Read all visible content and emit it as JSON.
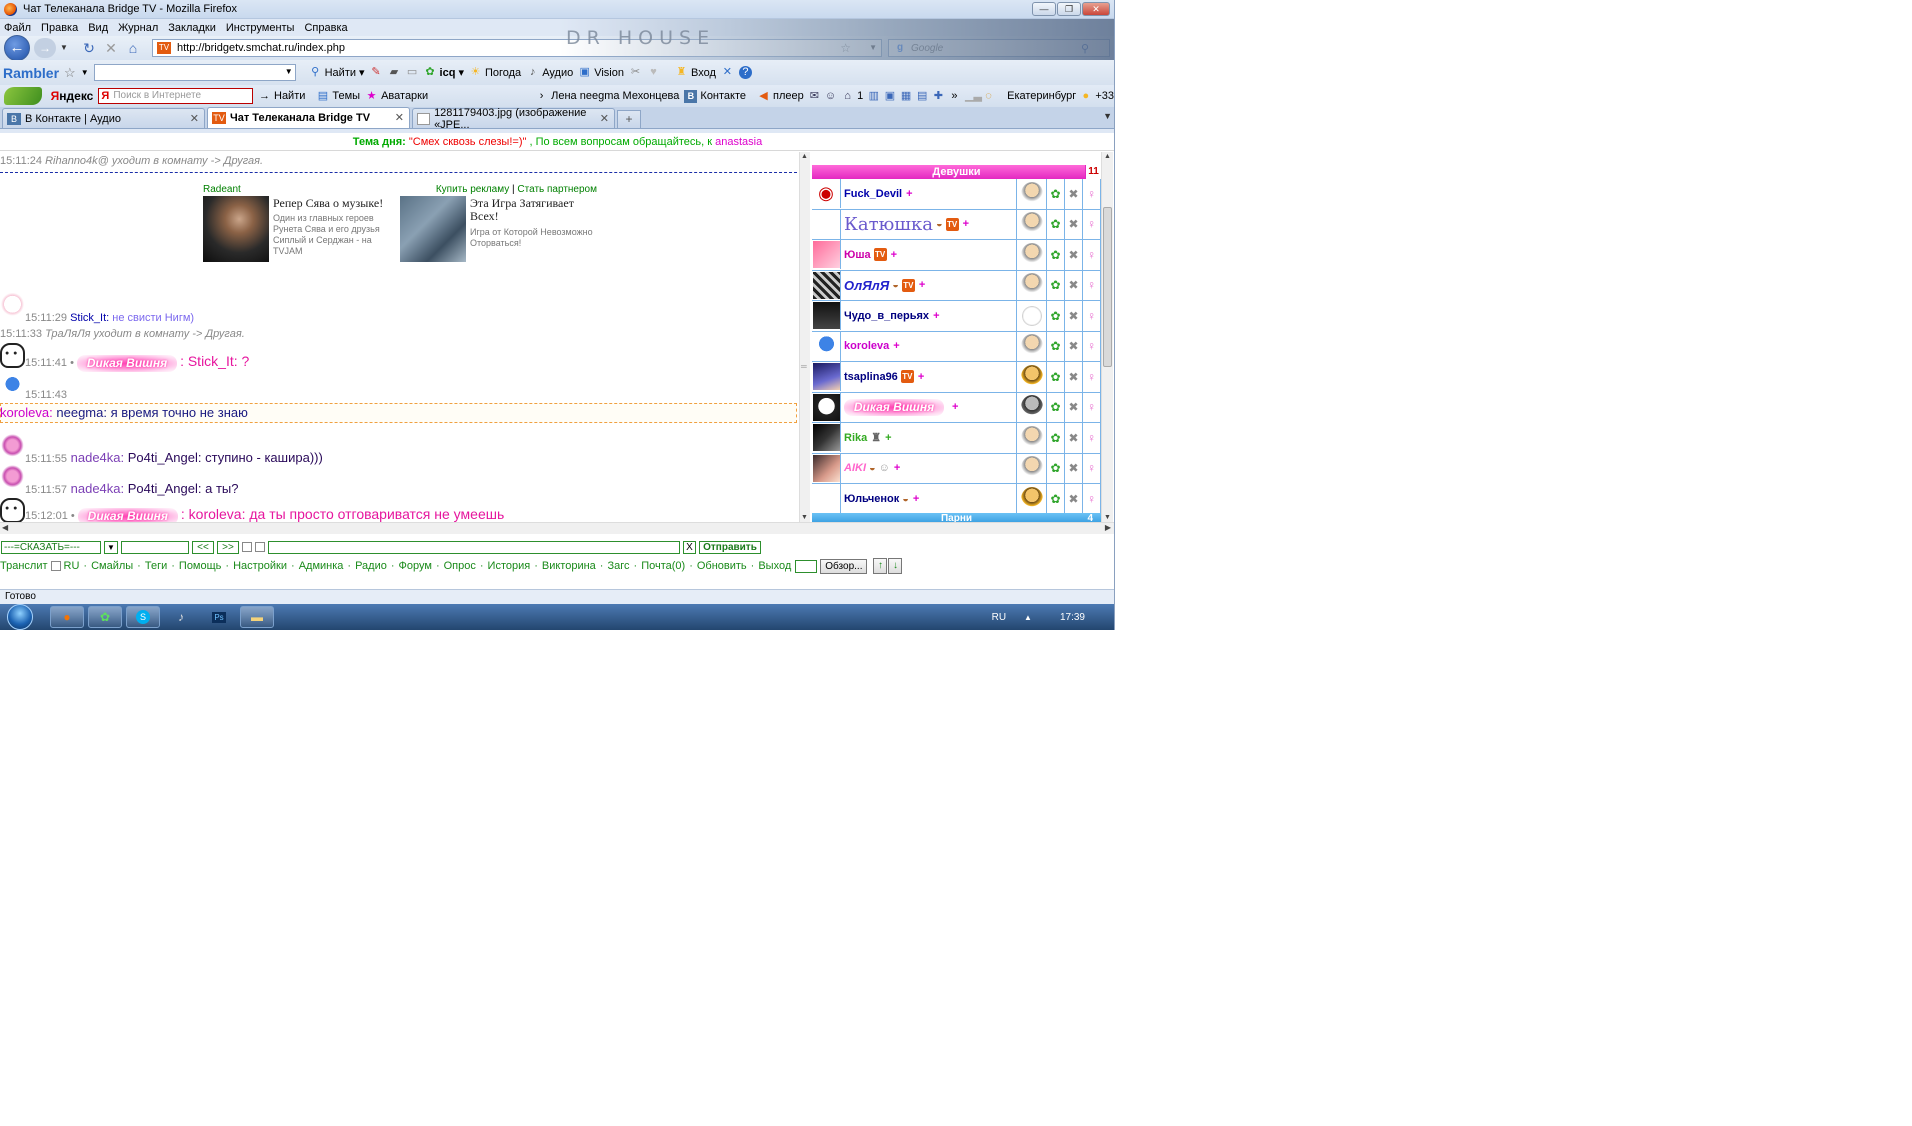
{
  "window": {
    "title": "Чат Телеканала Bridge TV - Mozilla Firefox",
    "buttons": {
      "min": "—",
      "max": "❐",
      "close": "✕"
    }
  },
  "menu": [
    "Файл",
    "Правка",
    "Вид",
    "Журнал",
    "Закладки",
    "Инструменты",
    "Справка"
  ],
  "nav": {
    "url": "http://bridgetv.smchat.ru/index.php",
    "search_placeholder": "Google",
    "banner_text": "DR HOUSE"
  },
  "rambler": {
    "logo": "Rambler",
    "find": "Найти",
    "icq": "icq",
    "weather": "Погода",
    "audio": "Аудио",
    "vision": "Vision",
    "login": "Вход"
  },
  "yandex": {
    "logo_y": "Я",
    "logo_rest": "ндекс",
    "search_placeholder": "Поиск в Интернете",
    "find": "Найти",
    "themes": "Темы",
    "avatars": "Аватарки",
    "profile": "Лена neegma Мехонцева",
    "vk": "Контакте",
    "player": "плеер",
    "counter": "1",
    "city": "Екатеринбург",
    "temp": "+33"
  },
  "tabs": [
    {
      "label": "В Контакте | Аудио",
      "icon": "B"
    },
    {
      "label": "Чат Телеканала Bridge TV",
      "icon": "TV"
    },
    {
      "label": "1281179403.jpg (изображение «JPE...",
      "icon": ""
    }
  ],
  "topic": {
    "label": "Тема дня:",
    "text": "\"Смех сквозь слезы!=)\"",
    "suffix": ", По всем вопросам обращайтесь, к",
    "admin": "anastasia"
  },
  "chat": {
    "msg1_ts": "15:11:24",
    "msg1_text": "Rihanno4k@ уходит в комнату -> Другая.",
    "ad": {
      "brand": "Radeant",
      "buy": "Купить рекламу",
      "partner": "Стать партнером",
      "head1": "Репер Сява о музыке!",
      "desc1": "Один из главных героев Рунета Сява и его друзья Сиплый и Серджан - на TVJAM",
      "head2": "Эта Игра Затягивает Всех!",
      "desc2": "Игра от Которой Невозможно Оторваться!"
    },
    "msg2_ts": "15:11:29",
    "msg2_user": "Stick_It:",
    "msg2_text": "не свисти Нигм)",
    "msg3_ts": "15:11:33",
    "msg3_text": "ТраЛяЛя уходит в комнату -> Другая.",
    "msg4_ts": "15:11:41",
    "msg4_glitter": "Dикая Вишня",
    "msg4_text": ": Stick_It: ?",
    "msg5_ts": "15:11:43",
    "msg5_user": "koroleva:",
    "msg5_text": "neegma: я время точно не знаю",
    "msg6_ts": "15:11:55",
    "msg6_user": "nade4ka:",
    "msg6_text": "Po4ti_Angel: ступино - кашира)))",
    "msg7_ts": "15:11:57",
    "msg7_user": "nade4ka:",
    "msg7_text": "Po4ti_Angel: а ты?",
    "msg8_ts": "15:12:01",
    "msg8_glitter": "Dикая Вишня",
    "msg8_text": ": koroleva: да ты просто отговариватся не умеешь"
  },
  "users": {
    "girls_label": "Девушки",
    "girls_count": "11",
    "boys_label": "Парни",
    "boys_count": "4",
    "list": [
      {
        "name": "Fuck_Devil",
        "color": "#0000aa"
      },
      {
        "name": "Катюшка",
        "color": "#6a5acd"
      },
      {
        "name": "Юша",
        "color": "#cc00aa"
      },
      {
        "name": "ОлЯлЯ",
        "color": "#2222cc"
      },
      {
        "name": "Чудо_в_перьях",
        "color": "#000080"
      },
      {
        "name": "koroleva",
        "color": "#cc00cc"
      },
      {
        "name": "tsaplina96",
        "color": "#000080"
      },
      {
        "name": "Dикая Вишня",
        "color": "#ff2a9f"
      },
      {
        "name": "Rika",
        "color": "#33aa22"
      },
      {
        "name": "AIKI",
        "color": "#ff66cc"
      },
      {
        "name": "Юльченок",
        "color": "#000080"
      }
    ],
    "plus": "+"
  },
  "input": {
    "say": "---=СКАЗАТЬ=---",
    "prev": "<<",
    "next": ">>",
    "clear": "X",
    "send": "Отправить"
  },
  "links": [
    "Транслит",
    "RU",
    "Смайлы",
    "Теги",
    "Помощь",
    "Настройки",
    "Админка",
    "Радио",
    "Форум",
    "Опрос",
    "История",
    "Викторина",
    "Загс",
    "Почта(0)",
    "Обновить",
    "Выход"
  ],
  "browse": "Обзор...",
  "status": "Готово",
  "tray": {
    "lang": "RU",
    "time": "17:39"
  }
}
